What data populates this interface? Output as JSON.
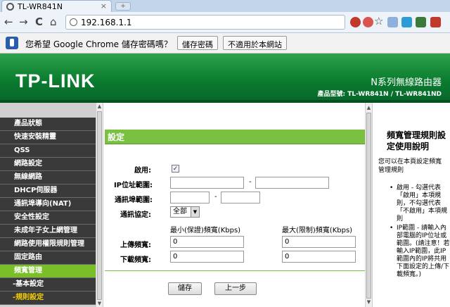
{
  "browser": {
    "tab_title": "TL-WR841N",
    "tab_close": "×",
    "url": "192.168.1.1",
    "back_glyph": "←",
    "forward_glyph": "→",
    "reload_glyph": "C",
    "home_glyph": "⌂",
    "star_glyph": "☆"
  },
  "password_bar": {
    "message": "您希望 Google Chrome 儲存密碼嗎？",
    "save_button": "儲存密碼",
    "never_button": "不適用於本網站"
  },
  "header": {
    "logo": "TP-LINK",
    "series": "N系列無線路由器",
    "model": "產品型號: TL-WR841N / TL-WR841ND"
  },
  "sidebar": {
    "items": [
      {
        "label": "產品狀態"
      },
      {
        "label": "快速安裝精靈"
      },
      {
        "label": "QSS"
      },
      {
        "label": "網路設定"
      },
      {
        "label": "無線網路"
      },
      {
        "label": "DHCP伺服器"
      },
      {
        "label": "通訊埠導向(NAT)"
      },
      {
        "label": "安全性設定"
      },
      {
        "label": "未成年子女上網管理"
      },
      {
        "label": "網路使用權限規則管理"
      },
      {
        "label": "固定路由"
      },
      {
        "label": "頻寬管理"
      },
      {
        "label": "-基本設定"
      },
      {
        "label": "-規則設定"
      }
    ]
  },
  "form": {
    "section_title": "設定",
    "enable_label": "啟用:",
    "enable_check": "✓",
    "ip_range_label": "IP位址範圍:",
    "port_range_label": "通訊埠範圍:",
    "protocol_label": "通訊協定:",
    "protocol_value": "全部",
    "dash": "-",
    "min_header": "最小(保證)頻寬(Kbps)",
    "max_header": "最大(限制)頻寬(Kbps)",
    "upload_label": "上傳頻寬:",
    "download_label": "下載頻寬:",
    "upload_min": "0",
    "upload_max": "0",
    "download_min": "0",
    "download_max": "0",
    "save_button": "儲存",
    "back_button": "上一步"
  },
  "help": {
    "title": "頻寬管理規則設定使用說明",
    "intro": "您可以在本頁設定頻寬管理規則",
    "items": [
      "啟用 - 勾選代表「啟用」本項規則，不勾選代表「不啟用」本項規則",
      "IP範圍 - 請輸入內部電腦的IP位址或範圍。(請注意！若輸入IP範圍，此IP範圍內的IP將共用下面設定的上傳/下載頻寬。)"
    ]
  },
  "colors": {
    "header_green": "#0a7c2f",
    "section_green": "#7ac142",
    "menu_dark": "#3a3a3a",
    "menu_active": "#7abf2a",
    "submenu_selected": "#f4d000"
  }
}
